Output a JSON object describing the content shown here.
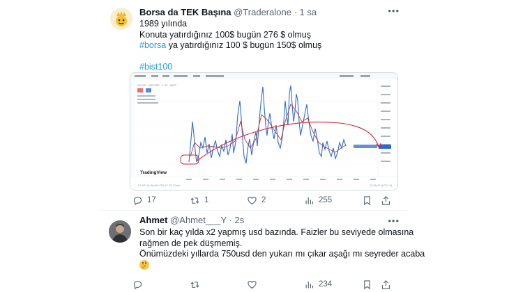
{
  "tweet1": {
    "name": "Borsa da TEK Başına",
    "handle": "@Traderalone",
    "time": "· 1 sa",
    "lines": {
      "l1": "1989 yılında",
      "l2": "Konuta yatırdığınız 100$ bugün 276 $ olmuş",
      "l3_tag": "#borsa",
      "l3_rest": " ya yatırdığınız 100 $ bugün 150$ olmuş",
      "l4_tag": "#bist100"
    },
    "media": {
      "chart_header": "XU100 · USDTRY · 1 AY · BIST",
      "watermark": "TradingView",
      "toolbar": "1G 5G 1A 3A 6A YTD 1Y 5Y Tümü",
      "clock": "13:45:47 (UTC+3)"
    },
    "actions": {
      "replies": "17",
      "retweets": "1",
      "likes": "2",
      "views": "255"
    }
  },
  "tweet2": {
    "name": "Ahmet",
    "handle": "@Ahmet___Y",
    "time": "· 2s",
    "lines": {
      "l1": "Son bir kaç yılda x2 yapmış usd bazında. Faizler bu seviyede olmasına",
      "l2": "rağmen de pek düşmemiş.",
      "l3": "Önümüzdeki yıllarda 750usd den yukarı mı çıkar aşağı mı seyreder acaba"
    },
    "actions": {
      "views": "234"
    }
  },
  "colors": {
    "accent": "#1d9bf0",
    "muted": "#536471",
    "series": "#2d6bd4",
    "arrow": "#d22b2b"
  },
  "icons": [
    "more-icon",
    "reply-icon",
    "retweet-icon",
    "like-icon",
    "views-icon",
    "bookmark-icon",
    "share-icon",
    "thinking-emoji-icon"
  ]
}
